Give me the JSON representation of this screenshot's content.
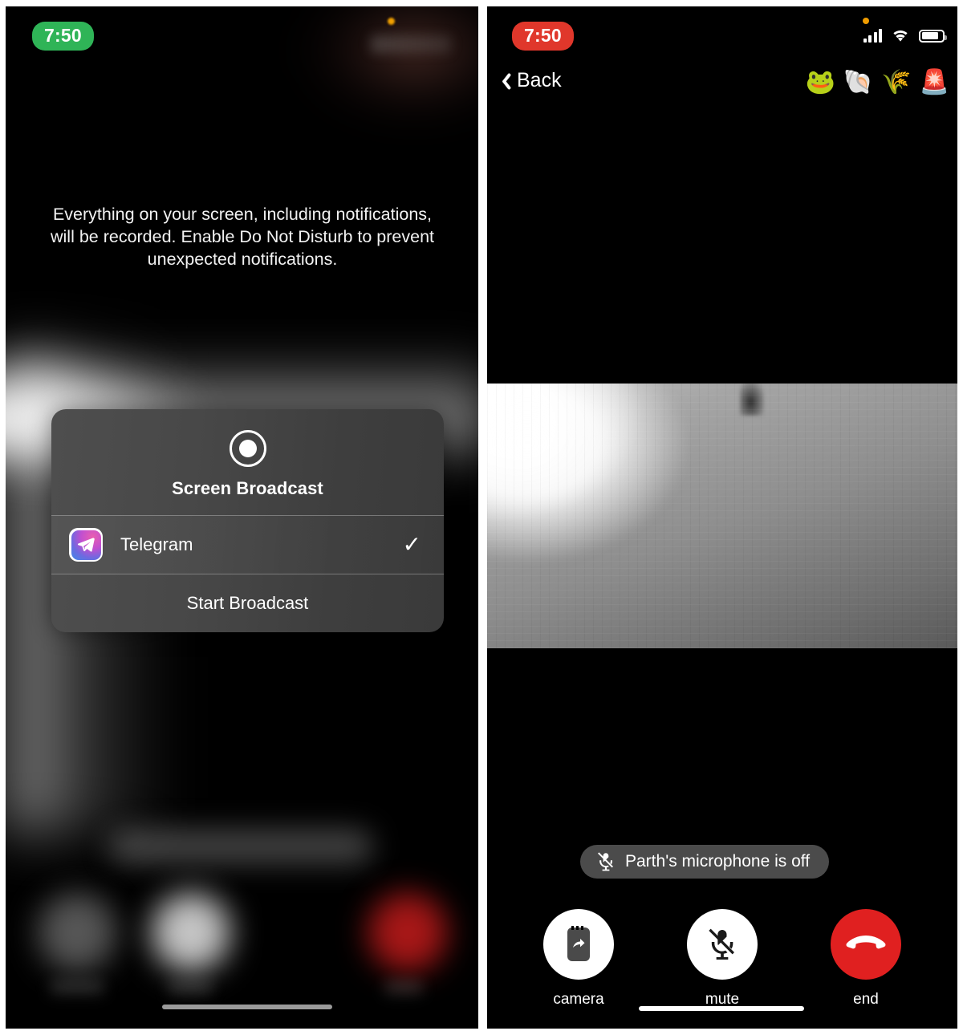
{
  "left_panel": {
    "status": {
      "time": "7:50",
      "time_pill_color": "#2fb457",
      "recording": true
    },
    "warning_text": "Everything on your screen, including notifications, will be recorded. Enable Do Not Disturb to prevent unexpected notifications.",
    "sheet": {
      "icon": "record-icon",
      "title": "Screen Broadcast",
      "app_row": {
        "icon": "telegram-icon",
        "label": "Telegram",
        "checkmark": "✓",
        "selected": true
      },
      "action_label": "Start Broadcast"
    }
  },
  "right_panel": {
    "status": {
      "time": "7:50",
      "time_pill_color": "#e0372b",
      "icons": [
        "cellular-signal-icon",
        "wifi-icon",
        "battery-icon"
      ]
    },
    "navbar": {
      "back_label": "Back",
      "back_icon": "chevron-left-icon",
      "emoji": [
        {
          "name": "frog-with-hat-emoji",
          "glyph": "🐸"
        },
        {
          "name": "spiral-shell-emoji",
          "glyph": "🐚"
        },
        {
          "name": "sheaf-of-rice-emoji",
          "glyph": "🌾"
        },
        {
          "name": "police-siren-emoji",
          "glyph": "🚨"
        }
      ]
    },
    "mic_banner": {
      "icon": "mic-off-icon",
      "text": "Parth's microphone is off"
    },
    "controls": [
      {
        "name": "camera-button",
        "label": "camera",
        "icon": "screen-share-icon",
        "style": "white"
      },
      {
        "name": "mute-button",
        "label": "mute",
        "icon": "mic-off-icon",
        "style": "white"
      },
      {
        "name": "end-call-button",
        "label": "end",
        "icon": "end-call-icon",
        "style": "red"
      }
    ]
  },
  "colors": {
    "recording_green": "#2fb457",
    "recording_red": "#e0372b",
    "end_call_red": "#e02020",
    "sheet_gray": "#484848",
    "banner_gray": "#4b4b4b"
  }
}
